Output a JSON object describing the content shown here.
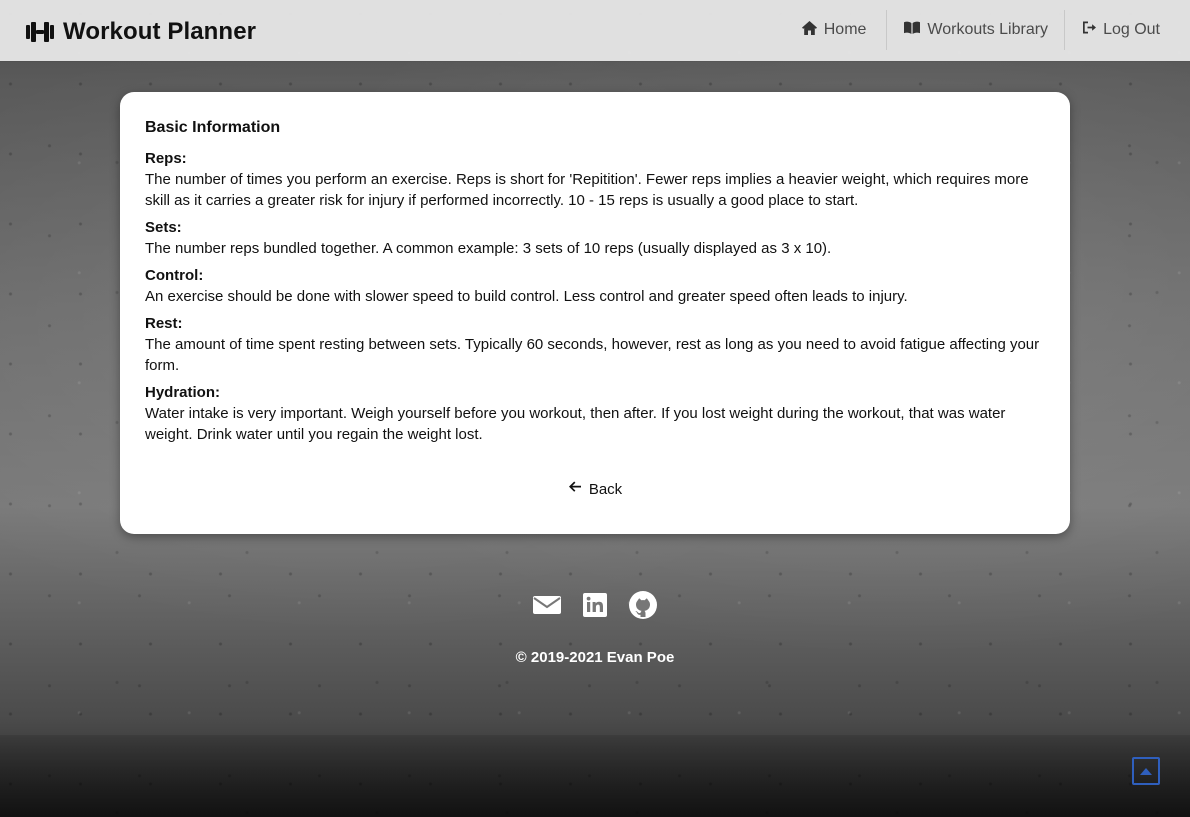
{
  "nav": {
    "brand_title": "Workout Planner",
    "links": [
      {
        "label": "Home",
        "icon": "home-icon"
      },
      {
        "label": "Workouts Library",
        "icon": "book-open-icon"
      },
      {
        "label": "Log Out",
        "icon": "logout-icon"
      }
    ]
  },
  "content": {
    "title": "Basic Information",
    "sections": [
      {
        "term": "Reps:",
        "definition": "The number of times you perform an exercise. Reps is short for 'Repitition'. Fewer reps implies a heavier weight, which requires more skill as it carries a greater risk for injury if performed incorrectly. 10 - 15 reps is usually a good place to start."
      },
      {
        "term": "Sets:",
        "definition": "The number reps bundled together. A common example: 3 sets of 10 reps (usually displayed as 3 x 10)."
      },
      {
        "term": "Control:",
        "definition": "An exercise should be done with slower speed to build control. Less control and greater speed often leads to injury."
      },
      {
        "term": "Rest:",
        "definition": "The amount of time spent resting between sets. Typically 60 seconds, however, rest as long as you need to avoid fatigue affecting your form."
      },
      {
        "term": "Hydration:",
        "definition": "Water intake is very important. Weigh yourself before you workout, then after. If you lost weight during the workout, that was water weight. Drink water until you regain the weight lost."
      }
    ],
    "back_label": "Back"
  },
  "footer": {
    "icons": [
      "envelope-icon",
      "linkedin-icon",
      "github-icon"
    ],
    "copyright": "© 2019-2021 Evan Poe"
  },
  "scroll_top": {
    "icon": "arrow-up-box-icon",
    "color": "#2f5fbd"
  },
  "colors": {
    "card_background": "#ffffff",
    "navbar_background": "#e6e6e6",
    "primary_text": "#111111",
    "muted_nav_text": "#4b4b4b",
    "footer_text": "#ffffff"
  }
}
